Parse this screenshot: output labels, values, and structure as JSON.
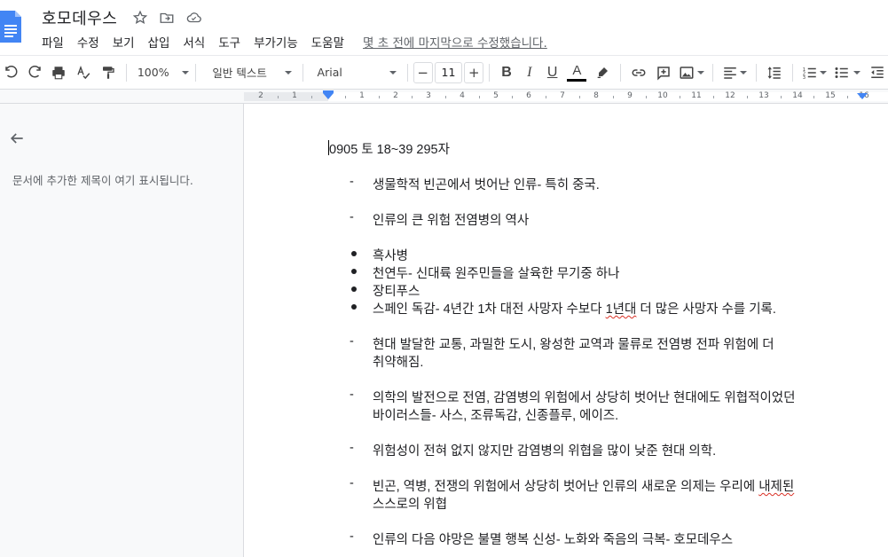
{
  "header": {
    "title": "호모데우스",
    "last_edit": "몇 초 전에 마지막으로 수정했습니다.",
    "menu": [
      "파일",
      "수정",
      "보기",
      "삽입",
      "서식",
      "도구",
      "부가기능",
      "도움말"
    ]
  },
  "toolbar": {
    "zoom": "100%",
    "style": "일반 텍스트",
    "font": "Arial",
    "font_size": "11",
    "minus": "−",
    "plus": "+",
    "bold": "B",
    "italic": "I",
    "underline": "U",
    "text_color_glyph": "A"
  },
  "ruler": {
    "numbers": [
      "2",
      "1",
      "1",
      "2",
      "3",
      "4",
      "5",
      "6",
      "7",
      "8",
      "9",
      "10",
      "11",
      "12",
      "13",
      "14",
      "15",
      "16"
    ]
  },
  "outline": {
    "hint": "문서에 추가한 제목이 여기 표시됩니다."
  },
  "document": {
    "heading": "0905 토 18~39 295자",
    "dash_symbol": "-",
    "dash_items": {
      "d1": "생물학적 빈곤에서 벗어난 인류- 특히 중국.",
      "d2": "인류의 큰 위험 전염병의 역사",
      "d3_l1": "현대 발달한 교통, 과밀한 도시, 왕성한 교역과 물류로 전염병 전파 위험에 더",
      "d3_l2": "취약해짐.",
      "d4_l1": "의학의 발전으로 전염, 감염병의 위험에서 상당히 벗어난 현대에도 위협적이었던",
      "d4_l2": "바이러스들- 사스, 조류독감, 신종플루, 에이즈.",
      "d5": "위험성이 전혀 없지 않지만 감염병의 위협을 많이 낮준 현대 의학.",
      "d6_l1a": "빈곤, 역병, 전쟁의 위험에서 상당히 벗어난 인류의 새로운 의제는 우리에 ",
      "d6_l1b": "내제된",
      "d6_l2": "스스로의 위협",
      "d7": "인류의 다음 야망은 불멸 행복 신성- 노화와 죽음의 극복- 호모데우스"
    },
    "bullets": {
      "b1": "흑사병",
      "b2": "천연두- 신대륙 원주민들을 살육한 무기중 하나",
      "b3": "장티푸스",
      "b4a": "스페인 독감- 4년간 1차 대전 사망자 수보다 ",
      "b4b": "1년대",
      "b4c": " 더 많은 사망자 수를 기록."
    }
  },
  "colors": {
    "docs_blue": "#4285f4",
    "spell_red": "#d93025",
    "text_color_bar": "#000000"
  }
}
